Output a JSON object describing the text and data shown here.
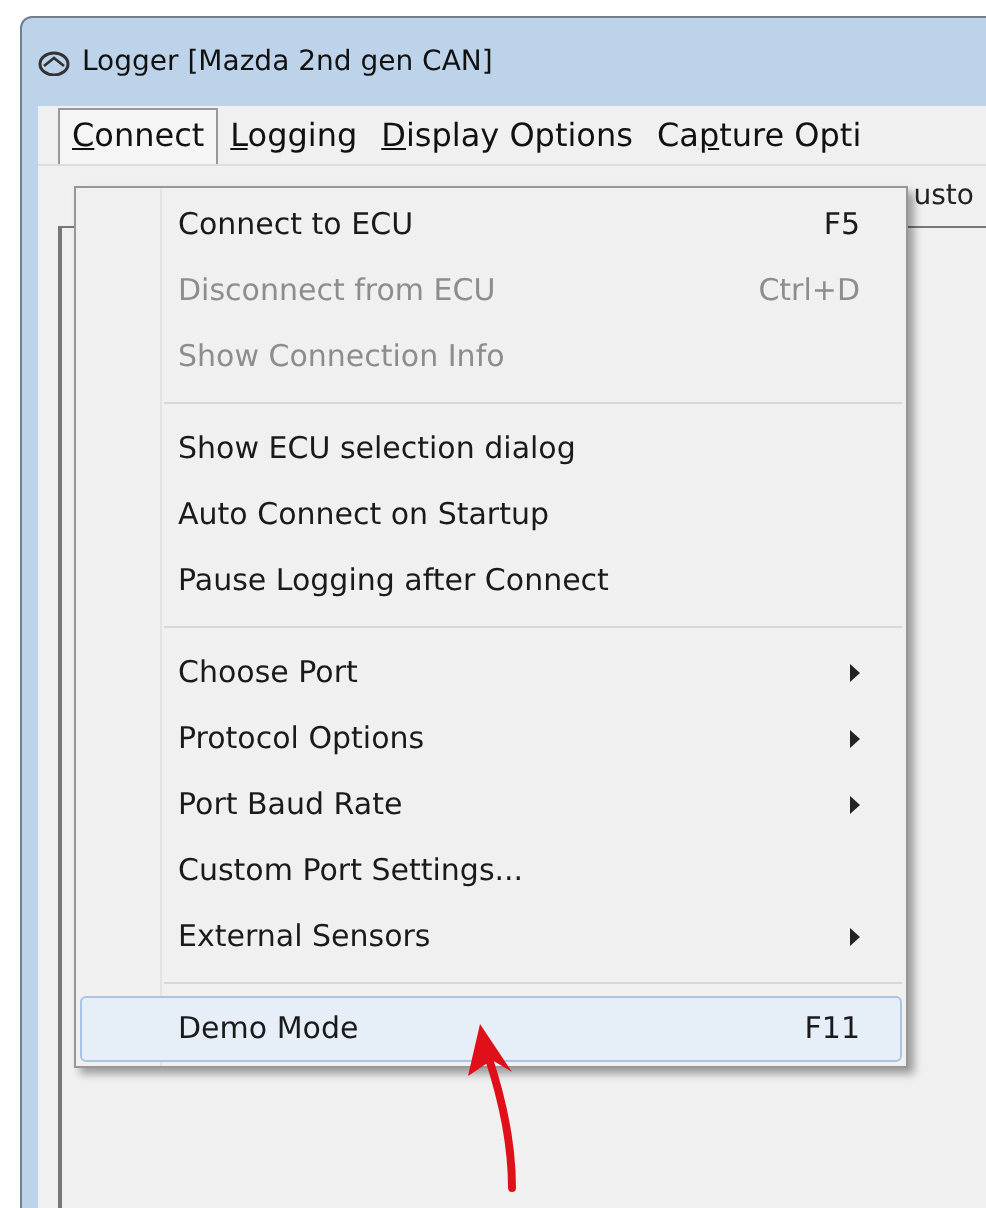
{
  "window": {
    "title": "Logger [Mazda 2nd gen CAN]"
  },
  "menu_bar": [
    {
      "key": "C",
      "after": "onnect",
      "selected": true
    },
    {
      "key": "L",
      "after": "ogging",
      "selected": false
    },
    {
      "key": "D",
      "after": "isplay Options",
      "selected": false
    },
    {
      "before": "Ca",
      "key": "p",
      "after": "ture Opti",
      "selected": false
    }
  ],
  "toolbar": {
    "partial_text": "usto"
  },
  "menu": [
    {
      "kind": "item",
      "label": "Connect to ECU",
      "shortcut": "F5",
      "disabled": false,
      "submenu": false,
      "selected": false
    },
    {
      "kind": "item",
      "label": "Disconnect from ECU",
      "shortcut": "Ctrl+D",
      "disabled": true,
      "submenu": false,
      "selected": false
    },
    {
      "kind": "item",
      "label": "Show Connection Info",
      "disabled": true,
      "submenu": false,
      "selected": false
    },
    {
      "kind": "separator"
    },
    {
      "kind": "item",
      "label": "Show ECU selection dialog",
      "disabled": false,
      "submenu": false,
      "selected": false
    },
    {
      "kind": "item",
      "label": "Auto Connect on Startup",
      "disabled": false,
      "submenu": false,
      "selected": false
    },
    {
      "kind": "item",
      "label": "Pause Logging after Connect",
      "disabled": false,
      "submenu": false,
      "selected": false
    },
    {
      "kind": "separator"
    },
    {
      "kind": "item",
      "label": "Choose Port",
      "disabled": false,
      "submenu": true,
      "selected": false
    },
    {
      "kind": "item",
      "label": "Protocol Options",
      "disabled": false,
      "submenu": true,
      "selected": false
    },
    {
      "kind": "item",
      "label": "Port Baud Rate",
      "disabled": false,
      "submenu": true,
      "selected": false
    },
    {
      "kind": "item",
      "label": "Custom Port Settings...",
      "disabled": false,
      "submenu": false,
      "selected": false
    },
    {
      "kind": "item",
      "label": "External Sensors",
      "disabled": false,
      "submenu": true,
      "selected": false
    },
    {
      "kind": "separator"
    },
    {
      "kind": "item",
      "label": "Demo Mode",
      "shortcut": "F11",
      "disabled": false,
      "submenu": false,
      "selected": true
    }
  ]
}
